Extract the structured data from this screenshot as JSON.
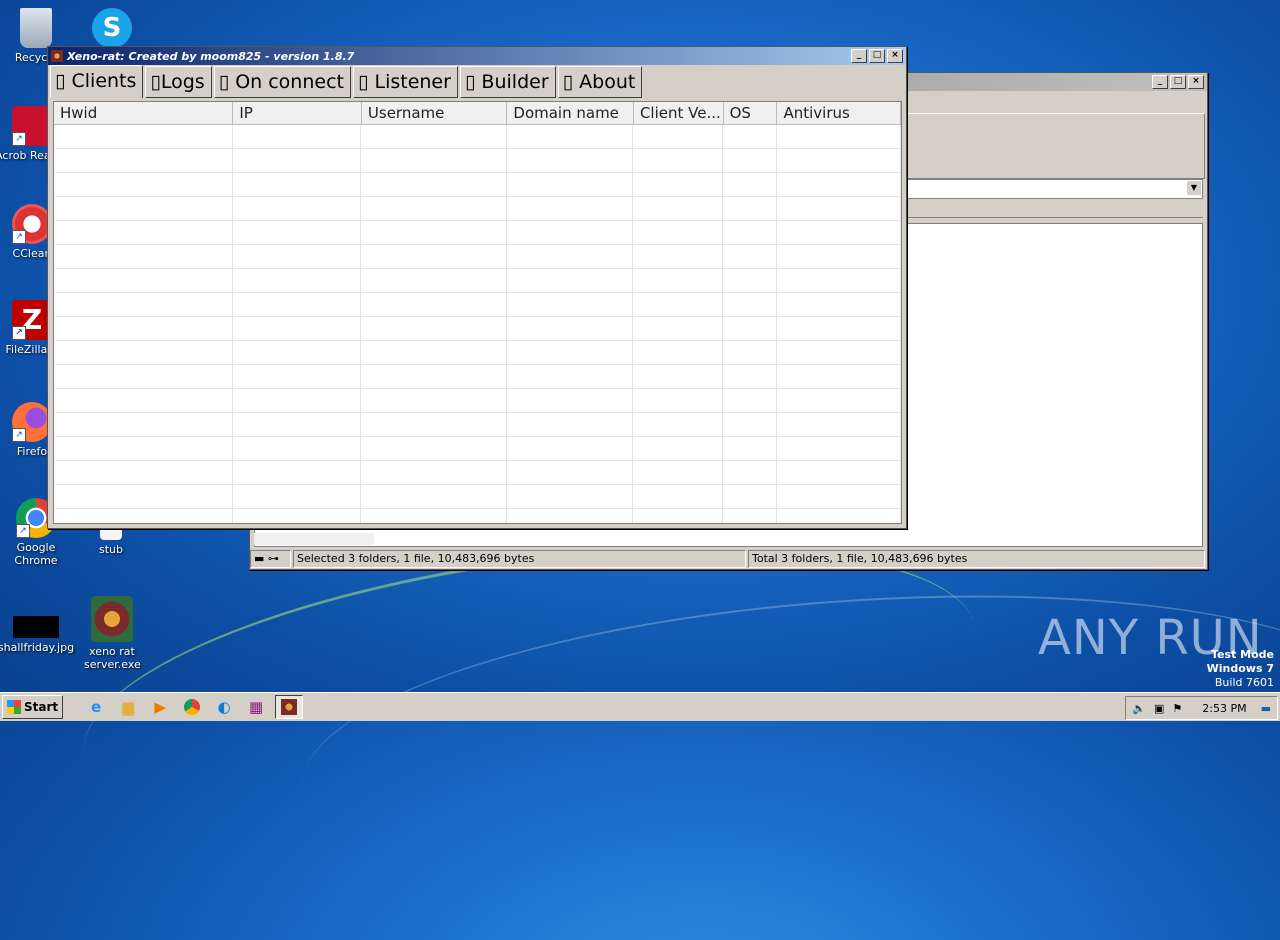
{
  "desktop": {
    "icons": [
      {
        "label": "Recycle",
        "icon": "recycle-bin-icon"
      },
      {
        "label": "Acrob Reader",
        "icon": "acrobat-icon"
      },
      {
        "label": "CClean",
        "icon": "ccleaner-icon"
      },
      {
        "label": "FileZilla C",
        "icon": "filezilla-icon"
      },
      {
        "label": "Firefo",
        "icon": "firefox-icon"
      },
      {
        "label": "Google Chrome",
        "icon": "chrome-icon"
      },
      {
        "label": "shallfriday.jpg",
        "icon": "image-file-icon"
      },
      {
        "label": "stub",
        "icon": "file-icon"
      },
      {
        "label": "xeno rat server.exe",
        "icon": "exe-icon"
      }
    ],
    "watermark": "ANY RUN",
    "test_mode": {
      "line1": "Test Mode",
      "line2": "Windows 7",
      "line3": "Build 7601"
    }
  },
  "back_window": {
    "status_left": "Selected 3 folders, 1 file, 10,483,696 bytes",
    "status_right": "Total 3 folders, 1 file, 10,483,696 bytes"
  },
  "main_window": {
    "title": "Xeno-rat: Created by moom825 - version 1.8.7",
    "tabs": [
      {
        "label": "▯ Clients",
        "selected": true
      },
      {
        "label": "▯Logs"
      },
      {
        "label": "▯ On connect"
      },
      {
        "label": "▯ Listener"
      },
      {
        "label": "▯ Builder"
      },
      {
        "label": "▯ About"
      }
    ],
    "columns": [
      "Hwid",
      "IP",
      "Username",
      "Domain name",
      "Client Ve...",
      "OS",
      "Antivirus"
    ]
  },
  "taskbar": {
    "start_label": "Start",
    "clock": "2:53 PM"
  },
  "colors": {
    "titlebar_active": "#0a246a",
    "desktop": "#1a6cc8",
    "window_bg": "#d4d0c8"
  }
}
